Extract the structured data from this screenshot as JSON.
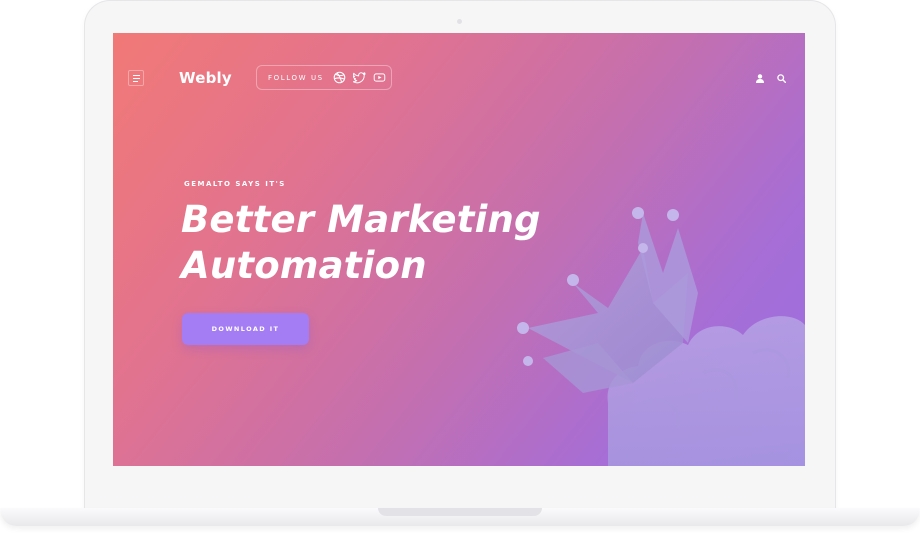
{
  "nav": {
    "logo": "Webly",
    "follow_label": "FOLLOW US",
    "social_icons": [
      "dribbble-icon",
      "twitter-icon",
      "youtube-icon"
    ],
    "right_icons": [
      "user-icon",
      "search-icon"
    ]
  },
  "hero": {
    "kicker": "GEMALTO SAYS IT'S",
    "headline_line1": "Better Marketing",
    "headline_line2": "Automation",
    "cta_label": "DOWNLOAD IT"
  },
  "colors": {
    "gradient_start": "#f17976",
    "gradient_end": "#9a6ee2",
    "cta": "#a47cf3",
    "text": "#ffffff"
  }
}
